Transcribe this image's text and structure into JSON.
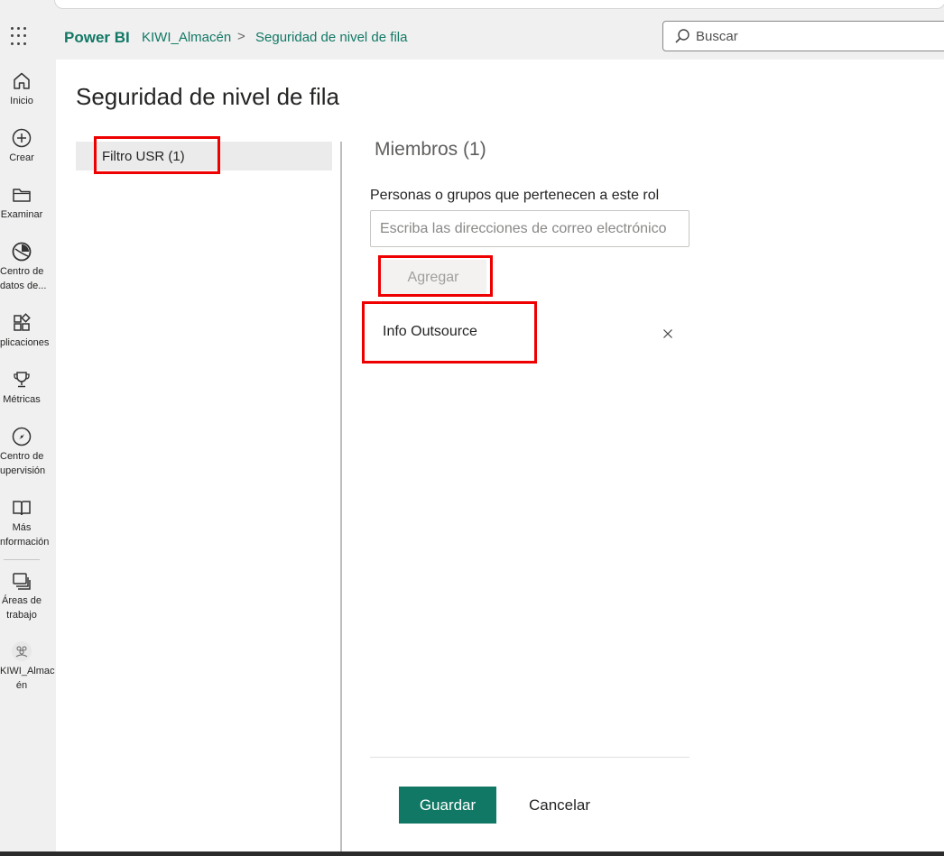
{
  "header": {
    "brand": "Power BI",
    "breadcrumb": [
      "KIWI_Almacén",
      "Seguridad de nivel de fila"
    ],
    "breadcrumb_separator": ">",
    "search_placeholder": "Buscar"
  },
  "nav": {
    "items": [
      {
        "icon": "home-icon",
        "label": "Inicio"
      },
      {
        "icon": "plus-circle-icon",
        "label": "Crear"
      },
      {
        "icon": "folder-icon",
        "label": "Examinar"
      },
      {
        "icon": "data-hub-icon",
        "label_line1": "Centro de",
        "label_line2": "datos de..."
      },
      {
        "icon": "apps-icon",
        "label": "plicaciones"
      },
      {
        "icon": "trophy-icon",
        "label": "Métricas"
      },
      {
        "icon": "monitor-hub-icon",
        "label_line1": "Centro de",
        "label_line2": "upervisión"
      },
      {
        "icon": "book-icon",
        "label_line1": "Más",
        "label_line2": "nformación"
      },
      {
        "icon": "workspaces-icon",
        "label_line1": "Áreas de",
        "label_line2": "trabajo"
      },
      {
        "icon": "workspace-avatar-icon",
        "label_line1": "KIWI_Almac",
        "label_line2": "én"
      }
    ]
  },
  "page": {
    "title": "Seguridad de nivel de fila"
  },
  "roles": [
    {
      "label": "Filtro USR (1)",
      "selected": true
    }
  ],
  "members": {
    "title": "Miembros (1)",
    "description": "Personas o grupos que pertenecen a este rol",
    "input_placeholder": "Escriba las direcciones de correo electrónico",
    "add_label": "Agregar",
    "list": [
      {
        "name": "Info Outsource"
      }
    ]
  },
  "footer": {
    "save_label": "Guardar",
    "cancel_label": "Cancelar"
  },
  "colors": {
    "accent": "#117865",
    "annotation": "#ee0000"
  }
}
